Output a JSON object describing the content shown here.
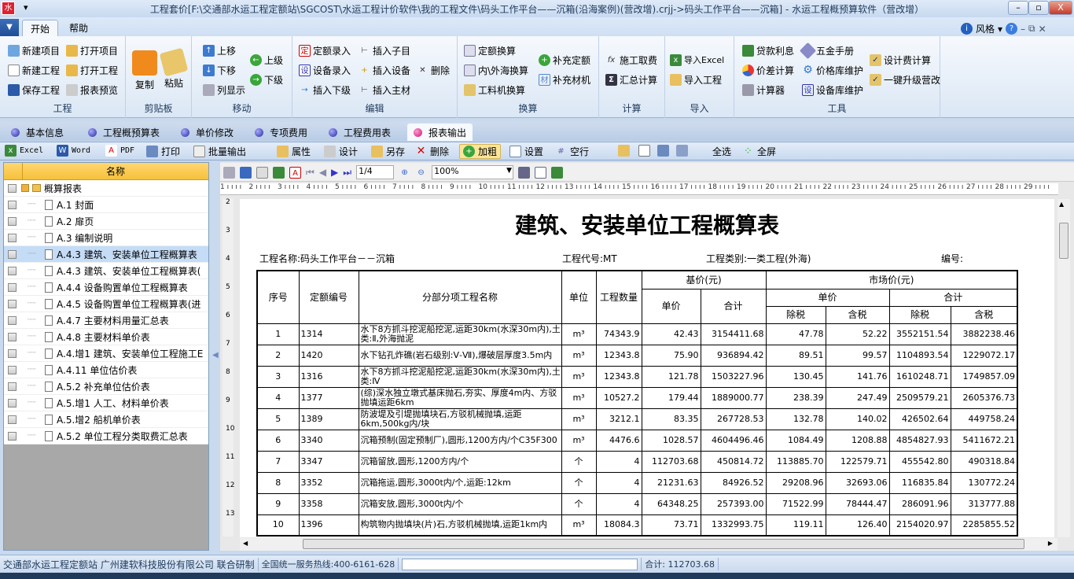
{
  "window": {
    "title": "工程套价[F:\\交通部水运工程定额站\\SGCOST\\水运工程计价软件\\我的工程文件\\码头工作平台——沉箱(沿海案例)(营改增).crjj->码头工作平台——沉箱] - 水运工程概预算软件（营改增）",
    "app_icon": "水"
  },
  "menu": {
    "tabs": [
      "开始",
      "帮助"
    ],
    "style": "风格"
  },
  "ribbon": {
    "groups": [
      {
        "label": "工程",
        "items": [
          "新建项目",
          "打开项目",
          "新建工程",
          "打开工程",
          "保存工程",
          "报表预览"
        ]
      },
      {
        "label": "剪贴板",
        "items": [
          "复制",
          "粘贴"
        ]
      },
      {
        "label": "移动",
        "items": [
          "上移",
          "下移",
          "列显示",
          "上级",
          "下级"
        ]
      },
      {
        "label": "编辑",
        "items": [
          "定额录入",
          "插入子目",
          "设备录入",
          "插入设备",
          "删除",
          "插入下级",
          "插入主材"
        ]
      },
      {
        "label": "换算",
        "items": [
          "定额换算",
          "内\\外海换算",
          "工料机换算",
          "补充定额",
          "补充材机"
        ]
      },
      {
        "label": "计算",
        "items": [
          "施工取费",
          "汇总计算"
        ]
      },
      {
        "label": "导入",
        "items": [
          "导入Excel",
          "导入工程"
        ]
      },
      {
        "label": "工具",
        "items": [
          "贷款利息",
          "五金手册",
          "设计费计算",
          "价差计算",
          "价格库维护",
          "一键升级营改",
          "计算器",
          "设备库维护"
        ]
      }
    ]
  },
  "view_tabs": [
    "基本信息",
    "工程概预算表",
    "单价修改",
    "专项费用",
    "工程费用表",
    "报表输出"
  ],
  "toolbar": [
    "Excel",
    "Word",
    "PDF",
    "打印",
    "批量输出",
    "属性",
    "设计",
    "另存",
    "删除",
    "加粗",
    "设置",
    "空行",
    "全选",
    "全屏"
  ],
  "tree": {
    "header": "名称",
    "root": "概算报表",
    "items": [
      "A.1 封面",
      "A.2 扉页",
      "A.3 编制说明",
      "A.4.3 建筑、安装单位工程概算表",
      "A.4.3 建筑、安装单位工程概算表(",
      "A.4.4 设备购置单位工程概算表",
      "A.4.5 设备购置单位工程概算表(进",
      "A.4.7 主要材料用量汇总表",
      "A.4.8 主要材料单价表",
      "A.4.增1 建筑、安装单位工程施工E",
      "A.4.11 单位估价表",
      "A.5.2 补充单位估价表",
      "A.5.增1 人工、材料单价表",
      "A.5.增2 船机单价表",
      "A.5.2 单位工程分类取费汇总表"
    ]
  },
  "preview": {
    "page": "1/4",
    "zoom": "100%"
  },
  "report": {
    "title": "建筑、安装单位工程概算表",
    "project_name": "工程名称:码头工作平台－－沉箱",
    "project_code": "工程代号:MT",
    "project_type": "工程类别:一类工程(外海)",
    "number": "编号:",
    "headers": {
      "seq": "序号",
      "code": "定额编号",
      "name": "分部分项工程名称",
      "unit": "单位",
      "qty": "工程数量",
      "base": "基价(元)",
      "market": "市场价(元)",
      "unit_price": "单价",
      "total": "合计",
      "excl": "除税",
      "incl": "含税"
    },
    "rows": [
      [
        "1",
        "1314",
        "水下8方抓斗挖泥船挖泥,运距30km(水深30m内),土类:Ⅱ,外海抛泥",
        "m³",
        "74343.9",
        "42.43",
        "3154411.68",
        "47.78",
        "52.22",
        "3552151.54",
        "3882238.46"
      ],
      [
        "2",
        "1420",
        "水下钻孔炸礁(岩石级别:Ⅴ-Ⅶ),爆破层厚度3.5m内",
        "m³",
        "12343.8",
        "75.90",
        "936894.42",
        "89.51",
        "99.57",
        "1104893.54",
        "1229072.17"
      ],
      [
        "3",
        "1316",
        "水下8方抓斗挖泥船挖泥,运距30km(水深30m内),土类:Ⅳ",
        "m³",
        "12343.8",
        "121.78",
        "1503227.96",
        "130.45",
        "141.76",
        "1610248.71",
        "1749857.09"
      ],
      [
        "4",
        "1377",
        "(综)深水独立墩式基床抛石,夯实、厚度4m内、方驳抛填运距6km",
        "m³",
        "10527.2",
        "179.44",
        "1889000.77",
        "238.39",
        "247.49",
        "2509579.21",
        "2605376.73"
      ],
      [
        "5",
        "1389",
        "防波堤及引堤抛填块石,方驳机械抛填,运距6km,500kg内/块",
        "m³",
        "3212.1",
        "83.35",
        "267728.53",
        "132.78",
        "140.02",
        "426502.64",
        "449758.24"
      ],
      [
        "6",
        "3340",
        "沉箱预制(固定预制厂),圆形,1200方内/个C35F300",
        "m³",
        "4476.6",
        "1028.57",
        "4604496.46",
        "1084.49",
        "1208.88",
        "4854827.93",
        "5411672.21"
      ],
      [
        "7",
        "3347",
        "沉箱留放,圆形,1200方内/个",
        "个",
        "4",
        "112703.68",
        "450814.72",
        "113885.70",
        "122579.71",
        "455542.80",
        "490318.84"
      ],
      [
        "8",
        "3352",
        "沉箱拖运,圆形,3000t内/个,运距:12km",
        "个",
        "4",
        "21231.63",
        "84926.52",
        "29208.96",
        "32693.06",
        "116835.84",
        "130772.24"
      ],
      [
        "9",
        "3358",
        "沉箱安放,圆形,3000t内/个",
        "个",
        "4",
        "64348.25",
        "257393.00",
        "71522.99",
        "78444.47",
        "286091.96",
        "313777.88"
      ],
      [
        "10",
        "1396",
        "构筑物内抛填块(片)石,方驳机械抛填,运距1km内",
        "m³",
        "18084.3",
        "73.71",
        "1332993.75",
        "119.11",
        "126.40",
        "2154020.97",
        "2285855.52"
      ]
    ]
  },
  "status": {
    "org": "交通部水运工程定额站 广州建软科技股份有限公司 联合研制",
    "hotline": "全国统一服务热线:400-6161-628",
    "total": "合计: 112703.68"
  }
}
